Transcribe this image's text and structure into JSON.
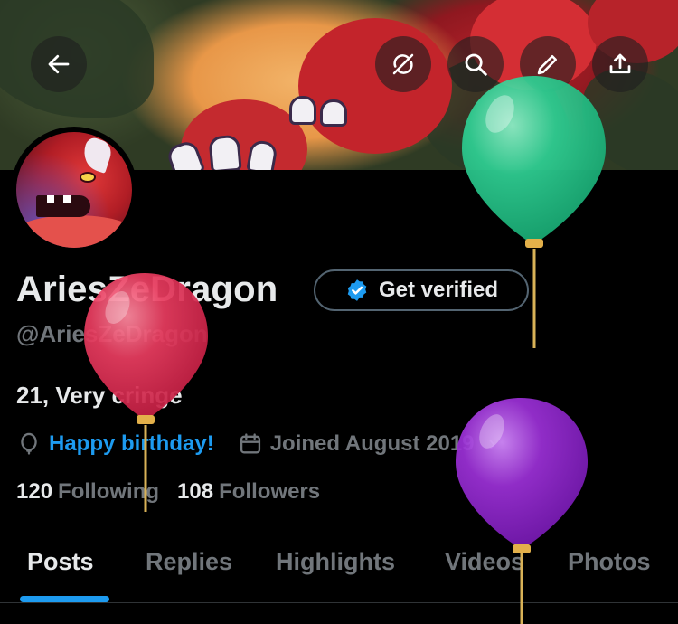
{
  "header": {
    "back_icon": "arrow-left-icon",
    "actions": [
      "refresh-off-icon",
      "search-icon",
      "pencil-icon",
      "share-icon"
    ]
  },
  "profile": {
    "display_name": "AriesZeDragon",
    "handle": "@AriesZeDragon",
    "verify_label": "Get verified",
    "bio": "21, Very cringe",
    "birthday_text": "Happy birthday!",
    "joined_text": "Joined August 2019",
    "joined_chevron": "›",
    "following_count": "120",
    "following_label": "Following",
    "followers_count": "108",
    "followers_label": "Followers"
  },
  "tabs": [
    {
      "label": "Posts"
    },
    {
      "label": "Replies"
    },
    {
      "label": "Highlights"
    },
    {
      "label": "Videos"
    },
    {
      "label": "Photos"
    }
  ],
  "colors": {
    "accent": "#1d9bf0",
    "muted": "#71767b",
    "text": "#e7e9ea",
    "balloon_green": "#2fcf93",
    "balloon_red": "#e83c5f",
    "balloon_purple": "#9b30d6"
  }
}
